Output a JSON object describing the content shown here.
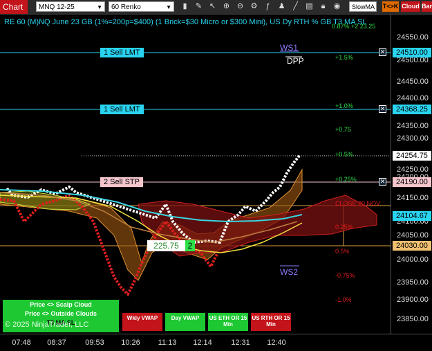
{
  "toolbar": {
    "tab_label": "Chart",
    "instrument": "MNQ 12-25",
    "interval": "60 Renko",
    "indicator_select": "SlowMA",
    "buttons": [
      "T<>K",
      "Cloud",
      "Bar"
    ]
  },
  "chart_header": "RE 60 (M)NQ June 23 GB (1%=200p=$400) (1 Brick=$30 Micro or $300 Mini), US Dy RTH % GB  T3 MA SL",
  "header_overlay": "0.87% +2 23.25",
  "price_axis": {
    "ticks": [
      "24550.00",
      "24500.00",
      "24450.00",
      "24400.00",
      "24350.00",
      "24300.00",
      "24250.00",
      "24200.00",
      "24150.00",
      "24100.00",
      "24050.00",
      "24000.00",
      "23950.00",
      "23900.00",
      "23850.00"
    ],
    "labels": [
      {
        "text": "24510.00",
        "bg": "#29d4f0"
      },
      {
        "text": "24368.25",
        "bg": "#29d4f0"
      },
      {
        "text": "24254.75",
        "bg": "#ffffff"
      },
      {
        "text": "24190.00",
        "bg": "#f4c6cc"
      },
      {
        "text": "24104.67",
        "bg": "#29d4f0"
      },
      {
        "text": "24030.00",
        "bg": "#f0c070"
      }
    ]
  },
  "time_axis": [
    "07:48",
    "08:37",
    "09:53",
    "10:26",
    "11:13",
    "12:14",
    "12:31",
    "12:40"
  ],
  "orders": [
    {
      "label": "1 Sell LMT",
      "bg": "#29d4f0"
    },
    {
      "label": "1 Sell LMT",
      "bg": "#29d4f0"
    },
    {
      "label": "2 Sell STP",
      "bg": "#f4c6cc"
    }
  ],
  "levels": {
    "ws1": "WS1",
    "dpp": "DPP",
    "ws2": "WS2",
    "close": "CLOSE 20 NOV"
  },
  "percent_labels": [
    "+1.5%",
    "+1.0%",
    "+0.75",
    "+0.5%",
    "+0.25%",
    "0.25%",
    "0.5%",
    "-0.75%",
    "-1.0%"
  ],
  "price_box": {
    "value": "225.75",
    "count": "2"
  },
  "left_buttons": [
    "Price <> Scalp Cloud",
    "Price <> Outside Clouds"
  ],
  "left_overlay": "T3 MA SL",
  "copyright": "© 2025 NinjaTrader, LLC",
  "bottom_buttons": [
    "Wkly VWAP",
    "Day VWAP",
    "US ETH OR 15 Min",
    "US RTH OR 15 Min"
  ],
  "close_icon": "close-x-icon",
  "colors": {
    "cyan": "#29d4f0",
    "green": "#2ee04a",
    "red": "#e01e1e",
    "orange": "#e0a040"
  }
}
